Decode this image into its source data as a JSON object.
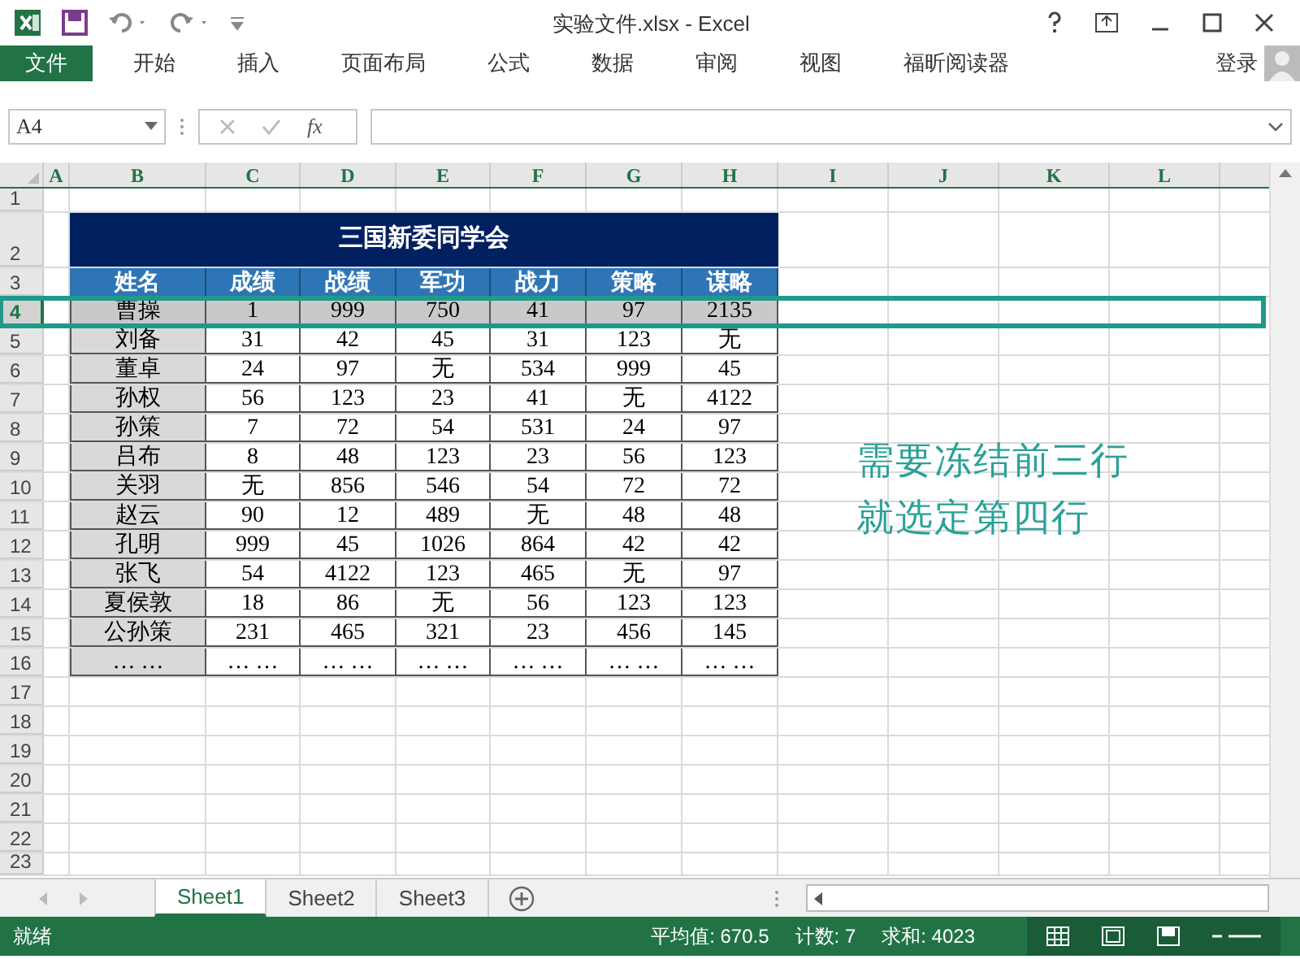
{
  "window": {
    "title": "实验文件.xlsx - Excel"
  },
  "ribbon_tabs": [
    {
      "label": "文件",
      "kind": "file",
      "selected": false
    },
    {
      "label": "开始",
      "kind": "tab",
      "selected": false
    },
    {
      "label": "插入",
      "kind": "tab",
      "selected": false
    },
    {
      "label": "页面布局",
      "kind": "tab",
      "selected": false
    },
    {
      "label": "公式",
      "kind": "tab",
      "selected": false
    },
    {
      "label": "数据",
      "kind": "tab",
      "selected": false
    },
    {
      "label": "审阅",
      "kind": "tab",
      "selected": false
    },
    {
      "label": "视图",
      "kind": "tab",
      "selected": false
    },
    {
      "label": "福昕阅读器",
      "kind": "tab",
      "selected": false
    }
  ],
  "account": {
    "label": "登录"
  },
  "name_box": {
    "value": "A4"
  },
  "formula_bar": {
    "function_label": "fx"
  },
  "columns": [
    "A",
    "B",
    "C",
    "D",
    "E",
    "F",
    "G",
    "H",
    "I",
    "J",
    "K",
    "L"
  ],
  "row_numbers": [
    {
      "label": "1",
      "selected": false
    },
    {
      "label": "2",
      "selected": false
    },
    {
      "label": "3",
      "selected": false
    },
    {
      "label": "4",
      "selected": true
    },
    {
      "label": "5",
      "selected": false
    },
    {
      "label": "6",
      "selected": false
    },
    {
      "label": "7",
      "selected": false
    },
    {
      "label": "8",
      "selected": false
    },
    {
      "label": "9",
      "selected": false
    },
    {
      "label": "10",
      "selected": false
    },
    {
      "label": "11",
      "selected": false
    },
    {
      "label": "12",
      "selected": false
    },
    {
      "label": "13",
      "selected": false
    },
    {
      "label": "14",
      "selected": false
    },
    {
      "label": "15",
      "selected": false
    },
    {
      "label": "16",
      "selected": false
    },
    {
      "label": "17",
      "selected": false
    },
    {
      "label": "18",
      "selected": false
    },
    {
      "label": "19",
      "selected": false
    },
    {
      "label": "20",
      "selected": false
    },
    {
      "label": "21",
      "selected": false
    },
    {
      "label": "22",
      "selected": false
    },
    {
      "label": "23",
      "selected": false
    }
  ],
  "table": {
    "title": "三国新委同学会",
    "header": [
      "姓名",
      "成绩",
      "战绩",
      "军功",
      "战力",
      "策略",
      "谋略"
    ],
    "rows": [
      [
        "曹操",
        "1",
        "999",
        "750",
        "41",
        "97",
        "2135"
      ],
      [
        "刘备",
        "31",
        "42",
        "45",
        "31",
        "123",
        "无"
      ],
      [
        "董卓",
        "24",
        "97",
        "无",
        "534",
        "999",
        "45"
      ],
      [
        "孙权",
        "56",
        "123",
        "23",
        "41",
        "无",
        "4122"
      ],
      [
        "孙策",
        "7",
        "72",
        "54",
        "531",
        "24",
        "97"
      ],
      [
        "吕布",
        "8",
        "48",
        "123",
        "23",
        "56",
        "123"
      ],
      [
        "关羽",
        "无",
        "856",
        "546",
        "54",
        "72",
        "72"
      ],
      [
        "赵云",
        "90",
        "12",
        "489",
        "无",
        "48",
        "48"
      ],
      [
        "孔明",
        "999",
        "45",
        "1026",
        "864",
        "42",
        "42"
      ],
      [
        "张飞",
        "54",
        "4122",
        "123",
        "465",
        "无",
        "97"
      ],
      [
        "夏侯敦",
        "18",
        "86",
        "无",
        "56",
        "123",
        "123"
      ],
      [
        "公孙策",
        "231",
        "465",
        "321",
        "23",
        "456",
        "145"
      ],
      [
        "… …",
        "… …",
        "… …",
        "… …",
        "… …",
        "… …",
        "… …"
      ]
    ]
  },
  "annotation": [
    "需要冻结前三行",
    "就选定第四行"
  ],
  "sheets": [
    {
      "label": "Sheet1",
      "selected": true
    },
    {
      "label": "Sheet2",
      "selected": false
    },
    {
      "label": "Sheet3",
      "selected": false
    }
  ],
  "status_bar": {
    "ready": "就绪",
    "average": "平均值: 670.5",
    "count": "计数: 7",
    "sum": "求和: 4023"
  }
}
